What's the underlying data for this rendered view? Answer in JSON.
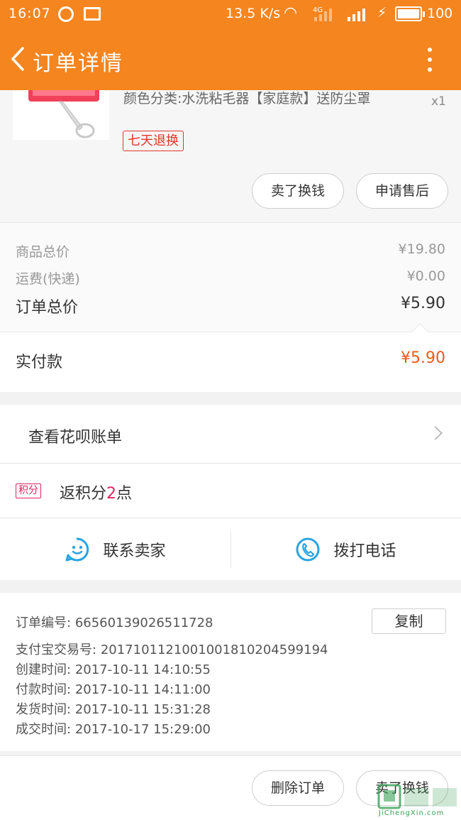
{
  "status_bar": {
    "time": "16:07",
    "speed": "13.5 K/s",
    "network": "4G",
    "battery": "100"
  },
  "header": {
    "title": "订单详情"
  },
  "product": {
    "variant_text": "颜色分类:水洗粘毛器【家庭款】送防尘罩",
    "quantity": "x1",
    "return_tag": "七天退换",
    "buttons": {
      "resell": "卖了换钱",
      "after_sale": "申请售后"
    }
  },
  "price_summary": {
    "goods_total_label": "商品总价",
    "goods_total": "¥19.80",
    "shipping_label": "运费(快递)",
    "shipping": "¥0.00",
    "order_total_label": "订单总价",
    "order_total": "¥5.90",
    "paid_label": "实付款",
    "paid": "¥5.90"
  },
  "huabei": {
    "label": "查看花呗账单"
  },
  "points": {
    "tag": "积分",
    "prefix": "返积分",
    "amount": "2",
    "suffix": "点"
  },
  "contact": {
    "seller": "联系卖家",
    "phone": "拨打电话"
  },
  "order_info": {
    "order_no_label": "订单编号:",
    "order_no": "66560139026511728",
    "copy_label": "复制",
    "alipay_label": "支付宝交易号:",
    "alipay_no": "2017101121001001810204599194",
    "created_label": "创建时间:",
    "created": "2017-10-11 14:10:55",
    "paid_label": "付款时间:",
    "paid": "2017-10-11 14:11:00",
    "shipped_label": "发货时间:",
    "shipped": "2017-10-11 15:31:28",
    "completed_label": "成交时间:",
    "completed": "2017-10-17 15:29:00"
  },
  "bottom_bar": {
    "delete": "删除订单",
    "resell": "卖了换钱"
  },
  "watermark": {
    "text": "JiChengXin.com"
  },
  "colors": {
    "brand_orange": "#f5851f",
    "price_red": "#f05a1a",
    "tag_red": "#e6342a",
    "points_pink": "#e0245e",
    "icon_blue": "#2aa3e0"
  }
}
